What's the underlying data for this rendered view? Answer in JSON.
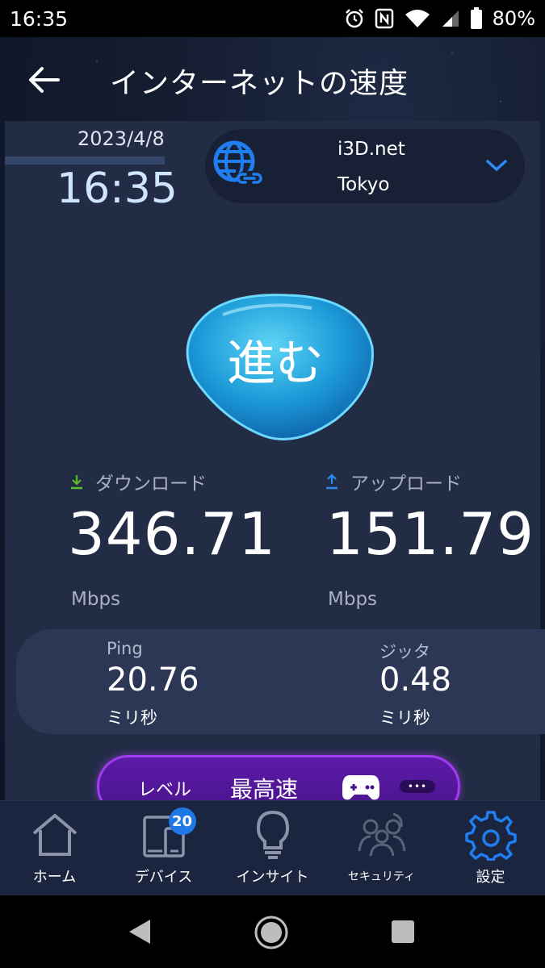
{
  "status_bar": {
    "time": "16:35",
    "battery": "80%",
    "icons": [
      "alarm-icon",
      "nfc-icon",
      "wifi-icon",
      "signal-icon",
      "battery-icon"
    ]
  },
  "header": {
    "title": "インターネットの速度"
  },
  "result": {
    "date": "2023/4/8",
    "time": "16:35"
  },
  "server": {
    "name": "i3D.net",
    "location": "Tokyo"
  },
  "go_button": {
    "label": "進む"
  },
  "download": {
    "label": "ダウンロード",
    "value": "346.71",
    "unit": "Mbps"
  },
  "upload": {
    "label": "アップロード",
    "value": "151.79",
    "unit": "Mbps"
  },
  "ping": {
    "label": "Ping",
    "value": "20.76",
    "unit": "ミリ秒"
  },
  "jitter": {
    "label": "ジッタ",
    "value": "0.48",
    "unit": "ミリ秒"
  },
  "level": {
    "label": "レベル",
    "value": "最高速",
    "more": "•••"
  },
  "bottom_nav": {
    "items": [
      {
        "label": "ホーム",
        "icon": "home-icon"
      },
      {
        "label": "デバイス",
        "icon": "devices-icon",
        "badge": "20"
      },
      {
        "label": "インサイト",
        "icon": "lightbulb-icon"
      },
      {
        "label": "セキュリティ",
        "icon": "family-icon"
      },
      {
        "label": "設定",
        "icon": "gear-icon"
      }
    ]
  },
  "colors": {
    "accent": "#1e78e6",
    "panel": "#222c45",
    "level_purple": "#5b1aa8"
  }
}
